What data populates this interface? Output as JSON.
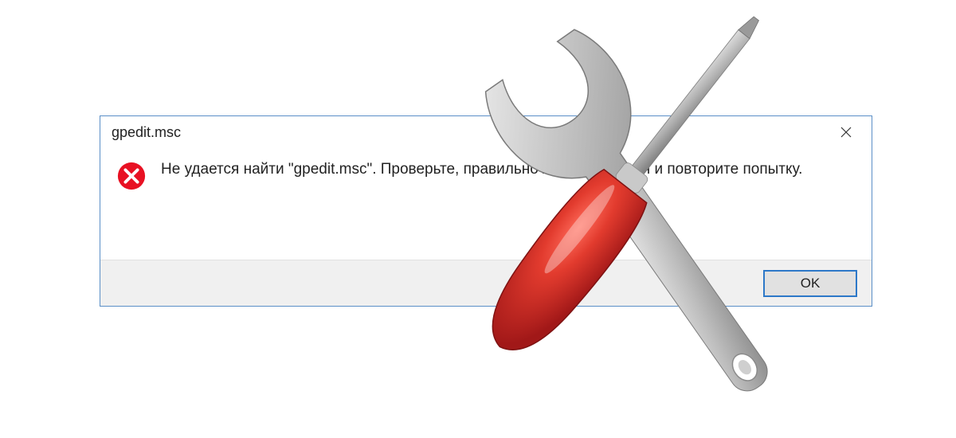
{
  "dialog": {
    "title": "gpedit.msc",
    "message": "Не удается найти \"gpedit.msc\". Проверьте, правильно ли указано имя и повторите попытку.",
    "ok_label": "OK",
    "close_label": "✕"
  },
  "icons": {
    "error": "error-circle-x",
    "close": "close-x",
    "tools": "wrench-screwdriver"
  },
  "colors": {
    "dialog_border": "#5b8fc7",
    "error_red": "#e81123",
    "ok_border": "#2d78c8",
    "footer_bg": "#f0f0f0",
    "screwdriver_handle": "#d33",
    "wrench": "#b9b9b9"
  }
}
